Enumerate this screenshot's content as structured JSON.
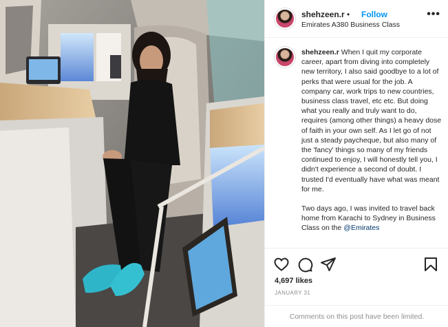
{
  "post": {
    "username": "shehzeen.r",
    "separator": "•",
    "follow_label": "Follow",
    "location": "Emirates A380 Business Class",
    "more_label": "•••",
    "caption_username": "shehzeen.r",
    "caption_p1": "When I quit my corporate career, apart from diving into completely new territory, I also said goodbye to a lot of perks that were usual for the job. A company car, work trips to new countries, business class travel, etc etc. But doing what you really and truly want to do, requires (among other things) a heavy dose of faith in your own self. As I let go of not just a steady paycheque, but also many of the 'fancy' things so many of my friends continued to enjoy, I will honestly tell you, I didn't experience a second of doubt. I trusted I'd eventually have what was meant for me.",
    "caption_p2": "Two days ago, I was invited to travel back home from Karachi to Sydney in Business Class on the",
    "caption_mention": "@Emirates",
    "likes": "4,697 likes",
    "date": "JANUARY 31",
    "comments_limited": "Comments on this post have been limited."
  },
  "icons": {
    "like": "heart-icon",
    "comment": "comment-icon",
    "share": "share-icon",
    "save": "bookmark-icon"
  },
  "colors": {
    "follow": "#0095f6",
    "mention": "#00376b",
    "muted": "#8e8e8e"
  }
}
